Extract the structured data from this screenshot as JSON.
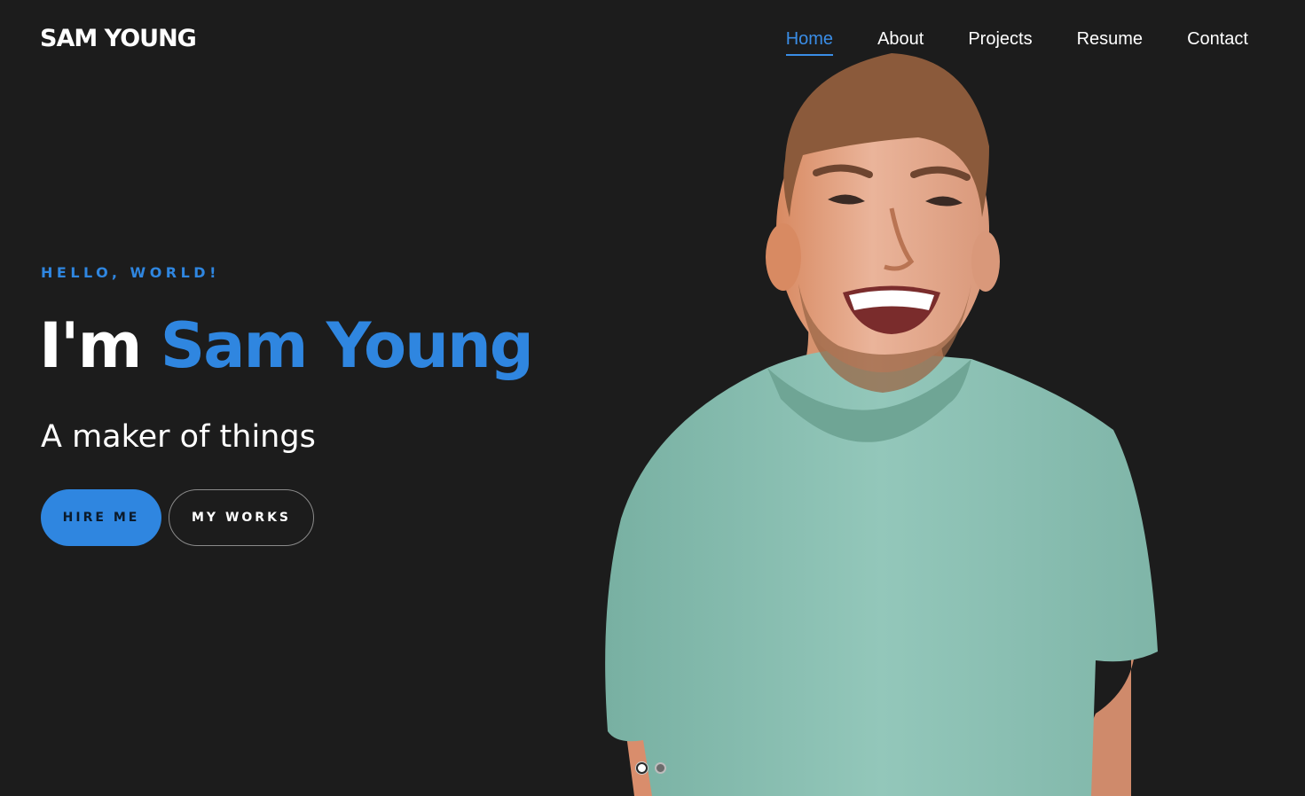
{
  "brand": {
    "logo_text": "SAM YOUNG"
  },
  "nav": {
    "items": [
      {
        "label": "Home",
        "active": true
      },
      {
        "label": "About",
        "active": false
      },
      {
        "label": "Projects",
        "active": false
      },
      {
        "label": "Resume",
        "active": false
      },
      {
        "label": "Contact",
        "active": false
      }
    ]
  },
  "hero": {
    "eyebrow": "HELLO, WORLD!",
    "headline_lead": "I'm",
    "headline_name": "Sam Young",
    "tagline": "A maker of things",
    "primary_button": "HIRE ME",
    "secondary_button": "MY WORKS",
    "portrait_icon": "person-portrait-photo"
  },
  "slider": {
    "total": 2,
    "active_index": 0
  },
  "colors": {
    "background": "#1c1c1c",
    "accent": "#2f86e0",
    "text": "#ffffff",
    "shirt": "#8cc1b4",
    "skin": "#e0a184"
  }
}
